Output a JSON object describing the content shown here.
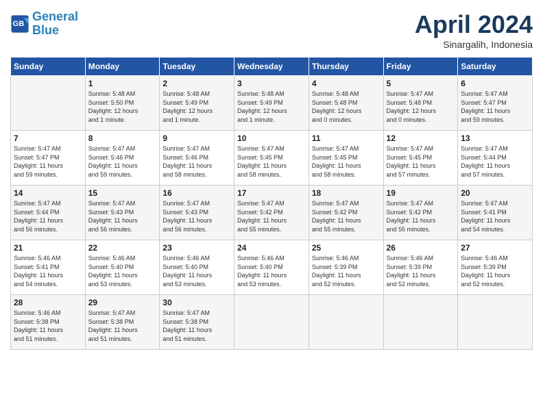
{
  "header": {
    "logo_general": "General",
    "logo_blue": "Blue",
    "month": "April 2024",
    "location": "Sinargalih, Indonesia"
  },
  "days_of_week": [
    "Sunday",
    "Monday",
    "Tuesday",
    "Wednesday",
    "Thursday",
    "Friday",
    "Saturday"
  ],
  "weeks": [
    [
      {
        "day": "",
        "info": ""
      },
      {
        "day": "1",
        "info": "Sunrise: 5:48 AM\nSunset: 5:50 PM\nDaylight: 12 hours\nand 1 minute."
      },
      {
        "day": "2",
        "info": "Sunrise: 5:48 AM\nSunset: 5:49 PM\nDaylight: 12 hours\nand 1 minute."
      },
      {
        "day": "3",
        "info": "Sunrise: 5:48 AM\nSunset: 5:49 PM\nDaylight: 12 hours\nand 1 minute."
      },
      {
        "day": "4",
        "info": "Sunrise: 5:48 AM\nSunset: 5:48 PM\nDaylight: 12 hours\nand 0 minutes."
      },
      {
        "day": "5",
        "info": "Sunrise: 5:47 AM\nSunset: 5:48 PM\nDaylight: 12 hours\nand 0 minutes."
      },
      {
        "day": "6",
        "info": "Sunrise: 5:47 AM\nSunset: 5:47 PM\nDaylight: 11 hours\nand 59 minutes."
      }
    ],
    [
      {
        "day": "7",
        "info": "Sunrise: 5:47 AM\nSunset: 5:47 PM\nDaylight: 11 hours\nand 59 minutes."
      },
      {
        "day": "8",
        "info": "Sunrise: 5:47 AM\nSunset: 5:46 PM\nDaylight: 11 hours\nand 59 minutes."
      },
      {
        "day": "9",
        "info": "Sunrise: 5:47 AM\nSunset: 5:46 PM\nDaylight: 11 hours\nand 58 minutes."
      },
      {
        "day": "10",
        "info": "Sunrise: 5:47 AM\nSunset: 5:45 PM\nDaylight: 11 hours\nand 58 minutes."
      },
      {
        "day": "11",
        "info": "Sunrise: 5:47 AM\nSunset: 5:45 PM\nDaylight: 11 hours\nand 58 minutes."
      },
      {
        "day": "12",
        "info": "Sunrise: 5:47 AM\nSunset: 5:45 PM\nDaylight: 11 hours\nand 57 minutes."
      },
      {
        "day": "13",
        "info": "Sunrise: 5:47 AM\nSunset: 5:44 PM\nDaylight: 11 hours\nand 57 minutes."
      }
    ],
    [
      {
        "day": "14",
        "info": "Sunrise: 5:47 AM\nSunset: 5:44 PM\nDaylight: 11 hours\nand 56 minutes."
      },
      {
        "day": "15",
        "info": "Sunrise: 5:47 AM\nSunset: 5:43 PM\nDaylight: 11 hours\nand 56 minutes."
      },
      {
        "day": "16",
        "info": "Sunrise: 5:47 AM\nSunset: 5:43 PM\nDaylight: 11 hours\nand 56 minutes."
      },
      {
        "day": "17",
        "info": "Sunrise: 5:47 AM\nSunset: 5:42 PM\nDaylight: 11 hours\nand 55 minutes."
      },
      {
        "day": "18",
        "info": "Sunrise: 5:47 AM\nSunset: 5:42 PM\nDaylight: 11 hours\nand 55 minutes."
      },
      {
        "day": "19",
        "info": "Sunrise: 5:47 AM\nSunset: 5:42 PM\nDaylight: 11 hours\nand 55 minutes."
      },
      {
        "day": "20",
        "info": "Sunrise: 5:47 AM\nSunset: 5:41 PM\nDaylight: 11 hours\nand 54 minutes."
      }
    ],
    [
      {
        "day": "21",
        "info": "Sunrise: 5:46 AM\nSunset: 5:41 PM\nDaylight: 11 hours\nand 54 minutes."
      },
      {
        "day": "22",
        "info": "Sunrise: 5:46 AM\nSunset: 5:40 PM\nDaylight: 11 hours\nand 53 minutes."
      },
      {
        "day": "23",
        "info": "Sunrise: 5:46 AM\nSunset: 5:40 PM\nDaylight: 11 hours\nand 53 minutes."
      },
      {
        "day": "24",
        "info": "Sunrise: 5:46 AM\nSunset: 5:40 PM\nDaylight: 11 hours\nand 53 minutes."
      },
      {
        "day": "25",
        "info": "Sunrise: 5:46 AM\nSunset: 5:39 PM\nDaylight: 11 hours\nand 52 minutes."
      },
      {
        "day": "26",
        "info": "Sunrise: 5:46 AM\nSunset: 5:39 PM\nDaylight: 11 hours\nand 52 minutes."
      },
      {
        "day": "27",
        "info": "Sunrise: 5:46 AM\nSunset: 5:39 PM\nDaylight: 11 hours\nand 52 minutes."
      }
    ],
    [
      {
        "day": "28",
        "info": "Sunrise: 5:46 AM\nSunset: 5:38 PM\nDaylight: 11 hours\nand 51 minutes."
      },
      {
        "day": "29",
        "info": "Sunrise: 5:47 AM\nSunset: 5:38 PM\nDaylight: 11 hours\nand 51 minutes."
      },
      {
        "day": "30",
        "info": "Sunrise: 5:47 AM\nSunset: 5:38 PM\nDaylight: 11 hours\nand 51 minutes."
      },
      {
        "day": "",
        "info": ""
      },
      {
        "day": "",
        "info": ""
      },
      {
        "day": "",
        "info": ""
      },
      {
        "day": "",
        "info": ""
      }
    ]
  ]
}
